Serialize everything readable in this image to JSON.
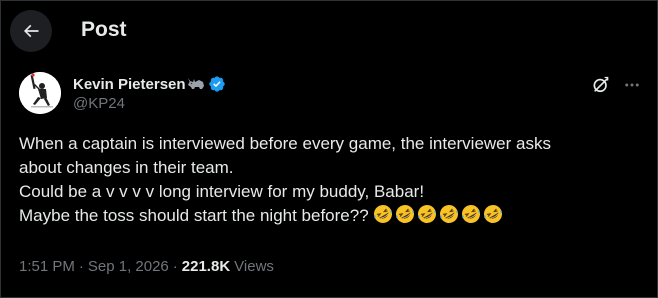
{
  "header": {
    "title": "Post",
    "back_icon": "arrow-left-icon"
  },
  "author": {
    "display_name": "Kevin Pietersen",
    "name_emoji": "rhino-emoji-icon",
    "verified": true,
    "verified_color": "#1d9bf0",
    "handle": "@KP24",
    "avatar": "batsman-silhouette-avatar"
  },
  "actions": {
    "grok_icon": "grok-icon",
    "more_icon": "more-horizontal-icon"
  },
  "tweet": {
    "lines": [
      "When a captain is interviewed before every game, the interviewer asks",
      "about changes in their team.",
      "Could be a v v v v long interview for my buddy, Babar!",
      "Maybe the toss should start the night before??"
    ],
    "emoji": "rolling-on-floor-laughing-emoji",
    "emoji_count": 6
  },
  "meta": {
    "time": "1:51 PM",
    "separator": "·",
    "date": "Sep 1, 2026",
    "views_count": "221.8K",
    "views_label": "Views"
  },
  "colors": {
    "background": "#000000",
    "text": "#e7e9ea",
    "secondary_text": "#71767b",
    "border": "#2f3336",
    "accent": "#1d9bf0"
  }
}
